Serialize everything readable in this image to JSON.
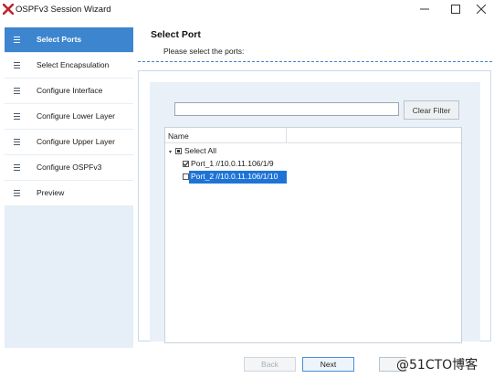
{
  "window": {
    "title": "OSPFv3 Session Wizard",
    "logo": "x-logo-icon"
  },
  "sidebar": {
    "items": [
      {
        "label": "Select Ports",
        "icon": "hamburger-icon",
        "active": true
      },
      {
        "label": "Select Encapsulation",
        "icon": "hamburger-icon",
        "active": false
      },
      {
        "label": "Configure Interface",
        "icon": "hamburger-icon",
        "active": false
      },
      {
        "label": "Configure Lower Layer",
        "icon": "hamburger-icon",
        "active": false
      },
      {
        "label": "Configure Upper Layer",
        "icon": "hamburger-icon",
        "active": false
      },
      {
        "label": "Configure OSPFv3",
        "icon": "hamburger-icon",
        "active": false
      },
      {
        "label": "Preview",
        "icon": "hamburger-icon",
        "active": false
      }
    ]
  },
  "content": {
    "title": "Select Port",
    "subtitle": "Please select the ports:",
    "filter": {
      "value": "",
      "placeholder": "",
      "clear_label": "Clear Filter"
    },
    "tree": {
      "column_header": "Name",
      "root": {
        "label": "Select All",
        "state": "partial",
        "expanded": true
      },
      "children": [
        {
          "label": "Port_1 //10.0.11.106/1/9",
          "checked": true,
          "selected": false
        },
        {
          "label": "Port_2 //10.0.11.106/1/10",
          "checked": false,
          "selected": true
        }
      ]
    }
  },
  "footer": {
    "back_label": "Back",
    "next_label": "Next",
    "watermark": "@51CTO博客"
  },
  "colors": {
    "accent": "#3d86cf",
    "selection": "#1e74d6",
    "sidebar_bg": "#e6eef7",
    "panel_bg": "#eaf0f7"
  }
}
